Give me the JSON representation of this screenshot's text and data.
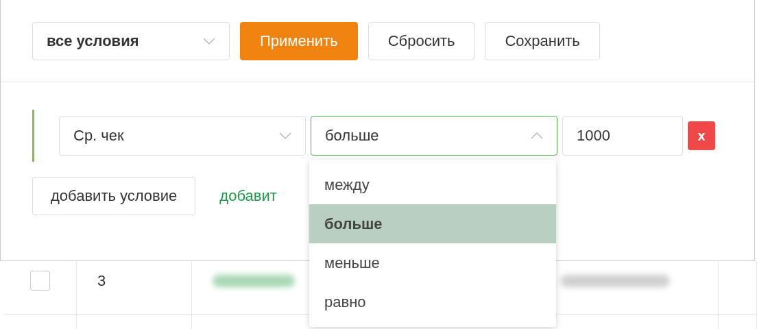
{
  "filter_bar": {
    "match_select": {
      "value": "все условия",
      "expanded": false
    },
    "buttons": [
      {
        "label": "Применить",
        "kind": "primary"
      },
      {
        "label": "Сбросить",
        "kind": "default"
      },
      {
        "label": "Сохранить",
        "kind": "default"
      }
    ]
  },
  "conditions": [
    {
      "field": "Ср. чек",
      "operator": "больше",
      "operator_expanded": true,
      "value": "1000",
      "remove_label": "x"
    }
  ],
  "add_condition_button": "добавить условие",
  "add_link": "добавит",
  "operator_menu": [
    {
      "label": "между",
      "selected": false
    },
    {
      "label": "больше",
      "selected": true
    },
    {
      "label": "меньше",
      "selected": false
    },
    {
      "label": "равно",
      "selected": false
    }
  ],
  "table": {
    "rows": [
      {
        "checked": false,
        "number": "3"
      }
    ]
  }
}
